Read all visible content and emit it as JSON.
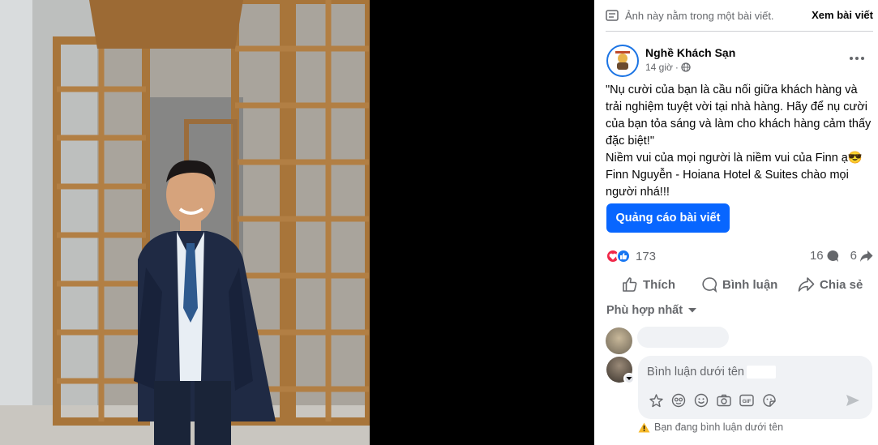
{
  "notice": {
    "text": "Ảnh này nằm trong một bài viết.",
    "link": "Xem bài viết",
    "icon": "post-icon"
  },
  "post": {
    "page_name": "Nghề Khách Sạn",
    "time": "14 giờ",
    "privacy_icon": "globe-icon",
    "paragraphs": [
      "\"Nụ cười của bạn là cầu nối giữa khách hàng và trải nghiệm tuyệt vời tại nhà hàng. Hãy để nụ cười của bạn tỏa sáng và làm cho khách hàng cảm thấy đặc biệt!\"",
      "Niềm vui của mọi người là niềm vui của Finn ạ😎",
      "Finn Nguyễn - Hoiana Hotel & Suites chào mọi người nhá!!!"
    ],
    "boost_label": "Quảng cáo bài viết"
  },
  "stats": {
    "reactions": "173",
    "comments": "16",
    "shares": "6"
  },
  "actions": {
    "like": "Thích",
    "comment": "Bình luận",
    "share": "Chia sẻ"
  },
  "sort_label": "Phù hợp nhất",
  "composer": {
    "placeholder": "Bình luận dưới tên",
    "warning": "Bạn đang bình luận dưới tên"
  },
  "colors": {
    "accent": "#0866ff",
    "love": "#f02849",
    "like": "#1877f2",
    "warning": "#f7b928"
  }
}
